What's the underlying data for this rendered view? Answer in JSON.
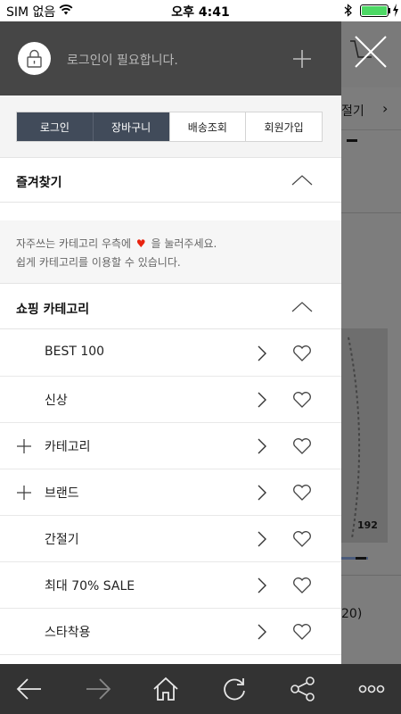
{
  "status_bar": {
    "carrier": "SIM 없음",
    "time": "오후 4:41"
  },
  "drawer": {
    "header": {
      "login_message": "로그인이 필요합니다."
    },
    "menu_tabs": [
      {
        "label": "로그인"
      },
      {
        "label": "장바구니"
      },
      {
        "label": "배송조회"
      },
      {
        "label": "회원가입"
      }
    ],
    "favorites": {
      "title": "즐겨찾기",
      "hint_line1_before": "자주쓰는 카테고리 우측에",
      "hint_line1_after": "을 눌러주세요.",
      "hint_line2": "쉽게 카테고리를 이용할 수 있습니다."
    },
    "shopping_category": {
      "title": "쇼핑 카테고리",
      "items": [
        {
          "label": "BEST 100",
          "expandable": false
        },
        {
          "label": "신상",
          "expandable": false
        },
        {
          "label": "카테고리",
          "expandable": true
        },
        {
          "label": "브랜드",
          "expandable": true
        },
        {
          "label": "간절기",
          "expandable": false
        },
        {
          "label": "최대 70% SALE",
          "expandable": false
        },
        {
          "label": "스타착용",
          "expandable": false
        }
      ]
    }
  },
  "background_page": {
    "tab_text": "절기",
    "badge_number": "192",
    "price_fragment": "20)"
  },
  "colors": {
    "drawer_header": "#464646",
    "active_tab": "#414b5a",
    "heart_accent": "#e8230f",
    "toolbar": "#333333",
    "battery": "#4cd964"
  }
}
